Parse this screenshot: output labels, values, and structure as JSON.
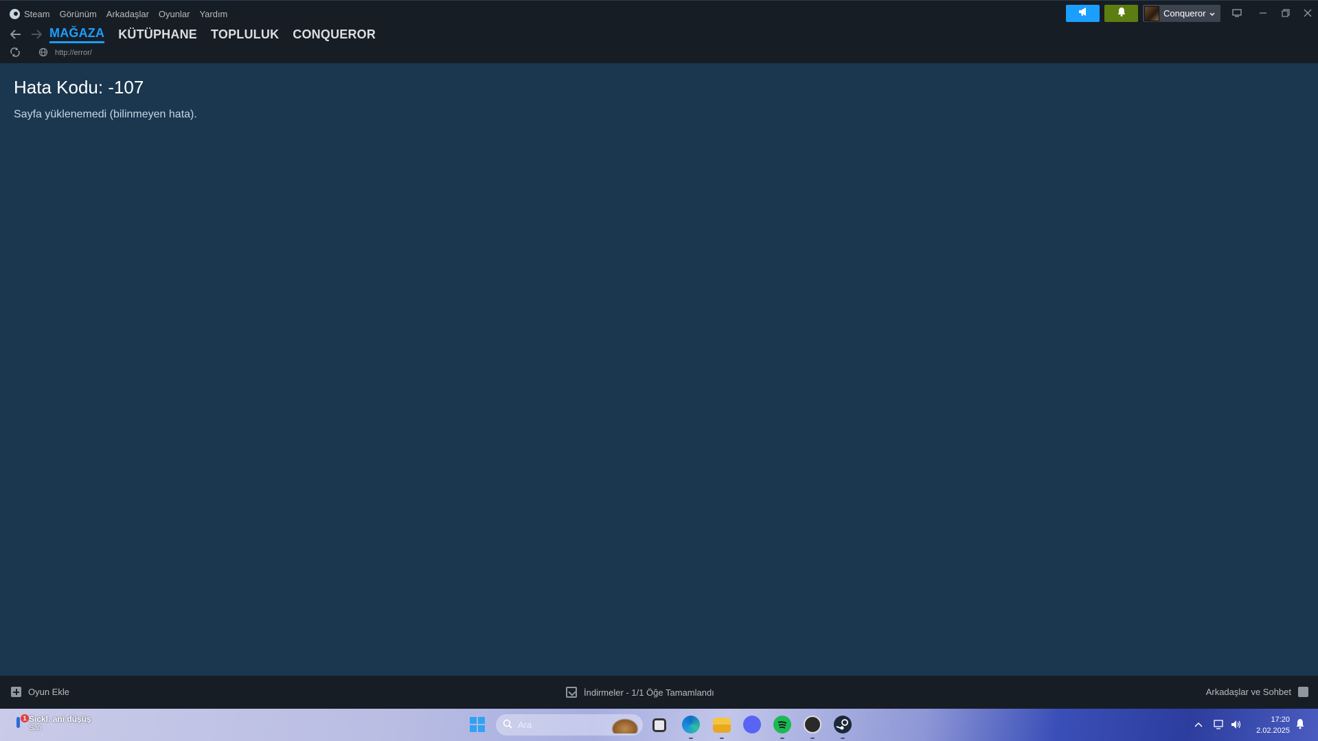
{
  "menu": {
    "items": [
      "Steam",
      "Görünüm",
      "Arkadaşlar",
      "Oyunlar",
      "Yardım"
    ]
  },
  "nav": {
    "tabs": [
      "MAĞAZA",
      "KÜTÜPHANE",
      "TOPLULUK",
      "CONQUEROR"
    ],
    "active_tab": "MAĞAZA"
  },
  "url": "http://error/",
  "account": {
    "name": "Conqueror"
  },
  "error": {
    "title": "Hata Kodu: -107",
    "message": "Sayfa yüklenemedi (bilinmeyen hata)."
  },
  "bottom_bar": {
    "add_game": "Oyun Ekle",
    "downloads": "İndirmeler - 1/1 Öğe Tamamlandı",
    "friends_chat": "Arkadaşlar ve Sohbet"
  },
  "taskbar": {
    "weather_title": "Sıckl. ani düşüş",
    "weather_day": "Salı",
    "weather_badge": "1",
    "search_placeholder": "Ara",
    "apps": [
      "widget-app-icon",
      "task-view-icon",
      "edge-icon",
      "file-explorer-icon",
      "discord-icon",
      "spotify-icon",
      "obs-icon",
      "steam-icon"
    ],
    "time": "17:20",
    "date": "2.02.2025"
  },
  "colors": {
    "accent_blue": "#1a9fff",
    "notif_green": "#5c7e10",
    "content_bg": "#1b3750",
    "chrome_bg": "#171d25"
  }
}
